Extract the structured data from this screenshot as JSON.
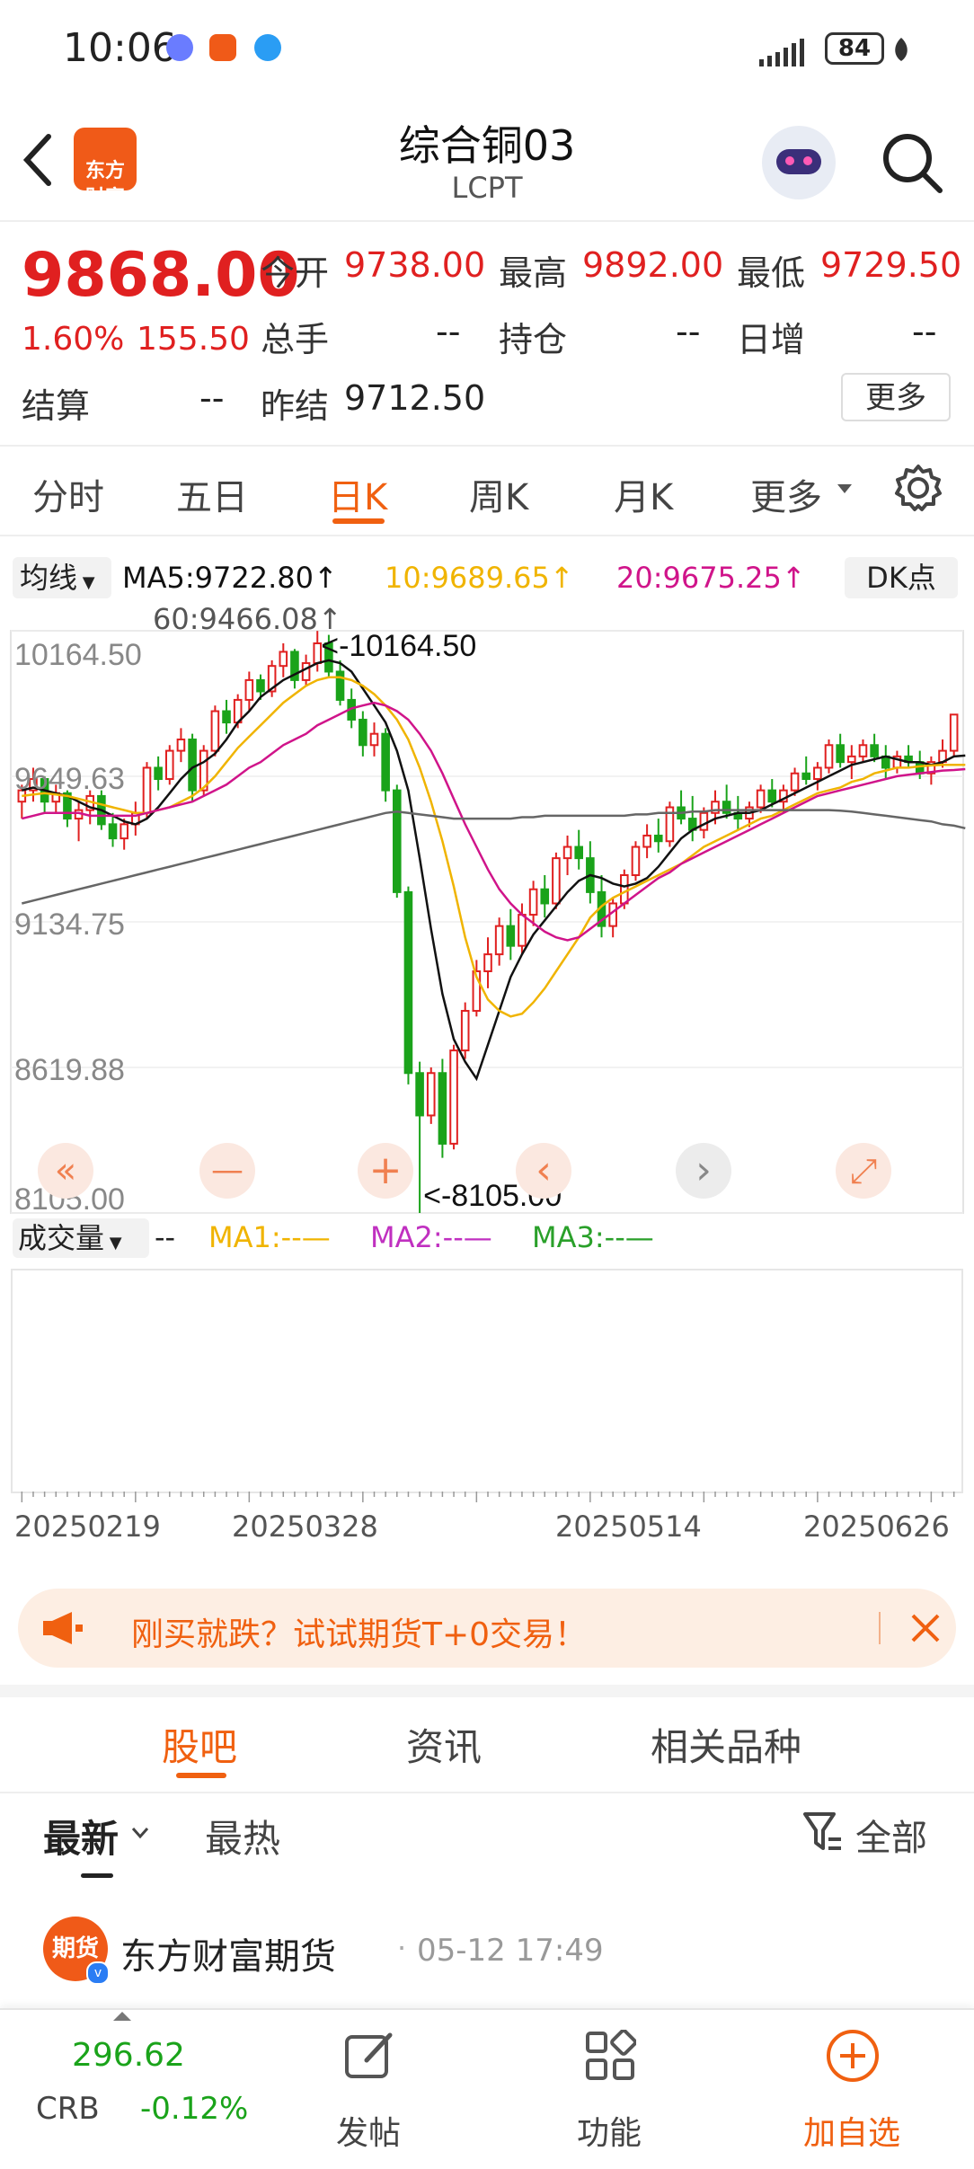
{
  "status_bar": {
    "time": "10:06",
    "battery": "84"
  },
  "header": {
    "logo_text": "东方\n财富",
    "title": "综合铜03",
    "subtitle": "LCPT"
  },
  "quote": {
    "price": "9868.00",
    "change_pct": "1.60%",
    "change_abs": "155.50",
    "open_label": "今开",
    "open": "9738.00",
    "high_label": "最高",
    "high": "9892.00",
    "low_label": "最低",
    "low": "9729.50",
    "volume_label": "总手",
    "volume": "--",
    "oi_label": "持仓",
    "oi": "--",
    "daily_inc_label": "日增",
    "daily_inc": "--",
    "settle_label": "结算",
    "settle": "--",
    "prev_settle_label": "昨结",
    "prev_settle": "9712.50",
    "more_button": "更多"
  },
  "tabs": [
    "分时",
    "五日",
    "日K",
    "周K",
    "月K",
    "更多"
  ],
  "tabs_active": "日K",
  "ma_row": {
    "selector": "均线",
    "ma5": "MA5:9722.80↑",
    "ma10": "10:9689.65↑",
    "ma20": "20:9675.25↑",
    "ma60": "60:9466.08↑",
    "dk_button": "DK点"
  },
  "volume_row": {
    "selector": "成交量",
    "dash": "--",
    "ma1": "MA1:--—",
    "ma2": "MA2:--—",
    "ma3": "MA3:--—"
  },
  "colors": {
    "up": "#e02020",
    "down": "#1aa31a",
    "ma5": "#111111",
    "ma10": "#f0b400",
    "ma20": "#d0148a",
    "ma60": "#666666",
    "accent": "#f06010"
  },
  "chart_data": {
    "type": "candlestick",
    "y_ticks": [
      "10164.50",
      "9649.63",
      "9134.75",
      "8619.88",
      "8105.00"
    ],
    "ylim": [
      8105.0,
      10164.5
    ],
    "x_ticks": [
      "20250219",
      "20250328",
      "20250514",
      "20250626"
    ],
    "max_label": "<-10164.50",
    "min_label": "<-8105.00",
    "candles": [
      [
        9560,
        9620,
        9500,
        9600
      ],
      [
        9600,
        9680,
        9560,
        9640
      ],
      [
        9640,
        9650,
        9520,
        9560
      ],
      [
        9560,
        9620,
        9520,
        9590
      ],
      [
        9590,
        9600,
        9470,
        9500
      ],
      [
        9500,
        9560,
        9420,
        9530
      ],
      [
        9530,
        9600,
        9480,
        9580
      ],
      [
        9580,
        9600,
        9460,
        9480
      ],
      [
        9480,
        9520,
        9400,
        9430
      ],
      [
        9430,
        9500,
        9390,
        9480
      ],
      [
        9480,
        9560,
        9440,
        9520
      ],
      [
        9520,
        9700,
        9500,
        9680
      ],
      [
        9680,
        9720,
        9600,
        9640
      ],
      [
        9640,
        9760,
        9620,
        9740
      ],
      [
        9740,
        9820,
        9700,
        9780
      ],
      [
        9780,
        9800,
        9560,
        9600
      ],
      [
        9600,
        9760,
        9580,
        9740
      ],
      [
        9740,
        9900,
        9720,
        9880
      ],
      [
        9880,
        9920,
        9800,
        9840
      ],
      [
        9840,
        9940,
        9820,
        9920
      ],
      [
        9920,
        10020,
        9880,
        9990
      ],
      [
        9990,
        10010,
        9920,
        9950
      ],
      [
        9950,
        10060,
        9930,
        10040
      ],
      [
        10040,
        10120,
        10000,
        10090
      ],
      [
        10090,
        10100,
        9960,
        9990
      ],
      [
        9990,
        10080,
        9970,
        10050
      ],
      [
        10050,
        10164,
        10020,
        10120
      ],
      [
        10120,
        10150,
        10000,
        10020
      ],
      [
        10020,
        10060,
        9900,
        9920
      ],
      [
        9920,
        9960,
        9820,
        9850
      ],
      [
        9850,
        9880,
        9720,
        9760
      ],
      [
        9760,
        9840,
        9720,
        9800
      ],
      [
        9800,
        9820,
        9560,
        9600
      ],
      [
        9600,
        9620,
        9220,
        9240
      ],
      [
        9240,
        9260,
        8560,
        8600
      ],
      [
        8600,
        8640,
        8105,
        8450
      ],
      [
        8450,
        8620,
        8420,
        8600
      ],
      [
        8600,
        8650,
        8300,
        8350
      ],
      [
        8350,
        8700,
        8330,
        8680
      ],
      [
        8680,
        8850,
        8650,
        8820
      ],
      [
        8820,
        9000,
        8800,
        8960
      ],
      [
        8960,
        9080,
        8900,
        9020
      ],
      [
        9020,
        9150,
        8980,
        9120
      ],
      [
        9120,
        9180,
        9000,
        9050
      ],
      [
        9050,
        9200,
        9020,
        9160
      ],
      [
        9160,
        9280,
        9120,
        9250
      ],
      [
        9250,
        9300,
        9150,
        9200
      ],
      [
        9200,
        9380,
        9180,
        9360
      ],
      [
        9360,
        9440,
        9300,
        9400
      ],
      [
        9400,
        9460,
        9320,
        9360
      ],
      [
        9360,
        9420,
        9200,
        9240
      ],
      [
        9240,
        9300,
        9080,
        9120
      ],
      [
        9120,
        9220,
        9080,
        9200
      ],
      [
        9200,
        9320,
        9180,
        9300
      ],
      [
        9300,
        9420,
        9280,
        9400
      ],
      [
        9400,
        9480,
        9360,
        9440
      ],
      [
        9440,
        9500,
        9380,
        9420
      ],
      [
        9420,
        9560,
        9400,
        9540
      ],
      [
        9540,
        9600,
        9480,
        9500
      ],
      [
        9500,
        9580,
        9420,
        9460
      ],
      [
        9460,
        9540,
        9430,
        9520
      ],
      [
        9520,
        9600,
        9480,
        9560
      ],
      [
        9560,
        9620,
        9500,
        9520
      ],
      [
        9520,
        9580,
        9460,
        9500
      ],
      [
        9500,
        9560,
        9470,
        9540
      ],
      [
        9540,
        9620,
        9520,
        9600
      ],
      [
        9600,
        9640,
        9540,
        9560
      ],
      [
        9560,
        9620,
        9520,
        9600
      ],
      [
        9600,
        9680,
        9580,
        9660
      ],
      [
        9660,
        9720,
        9620,
        9640
      ],
      [
        9640,
        9700,
        9600,
        9680
      ],
      [
        9680,
        9780,
        9660,
        9760
      ],
      [
        9760,
        9800,
        9680,
        9700
      ],
      [
        9700,
        9760,
        9640,
        9720
      ],
      [
        9720,
        9780,
        9700,
        9760
      ],
      [
        9760,
        9800,
        9700,
        9720
      ],
      [
        9720,
        9760,
        9640,
        9680
      ],
      [
        9680,
        9740,
        9660,
        9720
      ],
      [
        9720,
        9760,
        9680,
        9700
      ],
      [
        9700,
        9740,
        9640,
        9660
      ],
      [
        9660,
        9720,
        9620,
        9700
      ],
      [
        9700,
        9780,
        9680,
        9740
      ],
      [
        9740,
        9868,
        9720,
        9868
      ]
    ],
    "series": [
      {
        "name": "MA5",
        "values": [
          9600,
          9610,
          9600,
          9590,
          9580,
          9560,
          9540,
          9530,
          9510,
          9490,
          9480,
          9500,
          9540,
          9590,
          9640,
          9680,
          9700,
          9730,
          9780,
          9840,
          9880,
          9930,
          9960,
          9990,
          10010,
          10030,
          10050,
          10060,
          10050,
          10020,
          9960,
          9900,
          9840,
          9740,
          9600,
          9360,
          9110,
          8880,
          8720,
          8640,
          8580,
          8700,
          8820,
          8940,
          9020,
          9090,
          9140,
          9190,
          9240,
          9280,
          9300,
          9290,
          9270,
          9260,
          9270,
          9290,
          9330,
          9380,
          9430,
          9460,
          9480,
          9500,
          9510,
          9520,
          9520,
          9530,
          9550,
          9570,
          9590,
          9610,
          9630,
          9650,
          9670,
          9690,
          9700,
          9710,
          9720,
          9710,
          9700,
          9700,
          9690,
          9700,
          9720,
          9723
        ]
      },
      {
        "name": "MA10",
        "values": [
          9580,
          9585,
          9590,
          9585,
          9580,
          9570,
          9560,
          9550,
          9540,
          9530,
          9520,
          9520,
          9530,
          9540,
          9560,
          9580,
          9610,
          9650,
          9700,
          9750,
          9790,
          9830,
          9870,
          9910,
          9940,
          9970,
          9990,
          10000,
          10000,
          9990,
          9970,
          9940,
          9900,
          9850,
          9780,
          9680,
          9560,
          9420,
          9260,
          9080,
          8940,
          8860,
          8820,
          8800,
          8810,
          8850,
          8900,
          8960,
          9020,
          9080,
          9150,
          9190,
          9220,
          9240,
          9260,
          9280,
          9300,
          9320,
          9340,
          9370,
          9400,
          9420,
          9440,
          9460,
          9480,
          9500,
          9510,
          9530,
          9550,
          9570,
          9590,
          9600,
          9610,
          9630,
          9640,
          9660,
          9670,
          9680,
          9680,
          9685,
          9688,
          9690,
          9690,
          9690
        ]
      },
      {
        "name": "MA20",
        "values": [
          9500,
          9510,
          9520,
          9520,
          9520,
          9520,
          9510,
          9510,
          9510,
          9510,
          9510,
          9520,
          9530,
          9540,
          9550,
          9560,
          9580,
          9600,
          9620,
          9650,
          9680,
          9700,
          9730,
          9760,
          9780,
          9800,
          9830,
          9850,
          9870,
          9890,
          9900,
          9910,
          9900,
          9880,
          9850,
          9800,
          9740,
          9660,
          9570,
          9480,
          9400,
          9320,
          9250,
          9200,
          9160,
          9130,
          9100,
          9080,
          9070,
          9080,
          9110,
          9140,
          9170,
          9200,
          9230,
          9260,
          9290,
          9310,
          9340,
          9360,
          9380,
          9400,
          9420,
          9440,
          9460,
          9480,
          9500,
          9520,
          9540,
          9560,
          9580,
          9590,
          9600,
          9610,
          9620,
          9630,
          9640,
          9650,
          9655,
          9660,
          9665,
          9670,
          9672,
          9675
        ]
      },
      {
        "name": "MA60",
        "values": [
          9200,
          9210,
          9220,
          9230,
          9240,
          9250,
          9260,
          9270,
          9280,
          9290,
          9300,
          9310,
          9320,
          9330,
          9340,
          9350,
          9360,
          9370,
          9380,
          9390,
          9400,
          9410,
          9420,
          9430,
          9440,
          9450,
          9460,
          9470,
          9480,
          9490,
          9500,
          9510,
          9520,
          9525,
          9520,
          9515,
          9510,
          9505,
          9500,
          9500,
          9500,
          9500,
          9500,
          9500,
          9505,
          9505,
          9510,
          9510,
          9510,
          9510,
          9510,
          9510,
          9510,
          9510,
          9515,
          9515,
          9520,
          9520,
          9520,
          9525,
          9525,
          9530,
          9530,
          9530,
          9530,
          9530,
          9530,
          9530,
          9530,
          9530,
          9530,
          9530,
          9528,
          9525,
          9520,
          9515,
          9510,
          9505,
          9500,
          9495,
          9490,
          9480,
          9475,
          9466
        ]
      }
    ]
  },
  "chart_controls": [
    "«",
    "—",
    "+",
    "‹",
    "›",
    "⤢"
  ],
  "promo": {
    "text": "刚买就跌？试试期货T+0交易！"
  },
  "sub_tabs": [
    "股吧",
    "资讯",
    "相关品种"
  ],
  "feed": {
    "sort_latest": "最新",
    "sort_hot": "最热",
    "filter": "全部"
  },
  "post": {
    "author": "东方财富期货",
    "avatar_text": "期货",
    "time": "05-12 17:49"
  },
  "bottom_bar": {
    "crb_value": "296.62",
    "crb_label": "CRB",
    "crb_change": "-0.12%",
    "post_label": "发帖",
    "func_label": "功能",
    "add_label": "加自选"
  }
}
